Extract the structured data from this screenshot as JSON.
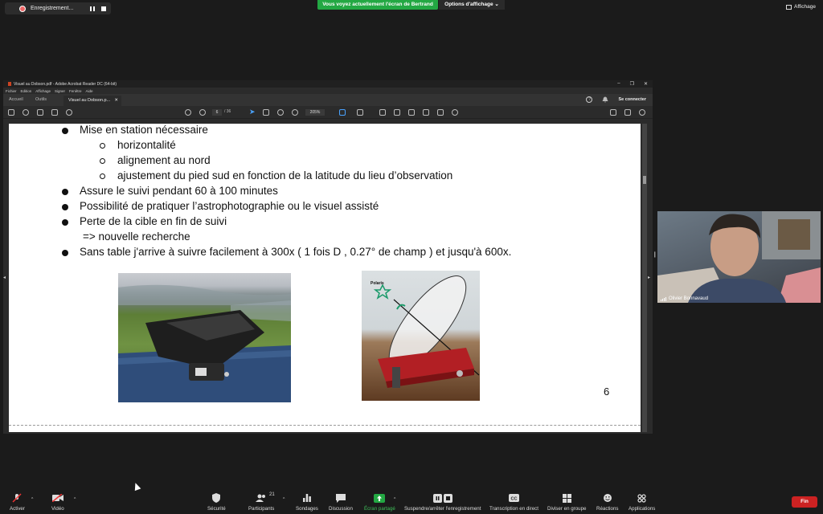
{
  "top": {
    "recording_label": "Enregistrement...",
    "share_banner": "Vous voyez actuellement l'écran de Bertrand",
    "view_options": "Options d'affichage",
    "view_options_caret": "⌄",
    "affichage": "Affichage"
  },
  "acrobat": {
    "window_title": "Visuel au Dobson.pdf - Adobe Acrobat Reader DC (64-bit)",
    "window_controls": [
      "–",
      "❐",
      "✕"
    ],
    "menu": [
      "Fichier",
      "Edition",
      "Affichage",
      "Signer",
      "Fenêtre",
      "Aide"
    ],
    "tabs": [
      "Accueil",
      "Outils"
    ],
    "doc_tab": "Visuel au Dobson.p...",
    "doc_tab_close": "✕",
    "help_glyph": "?",
    "connect": "Se connecter",
    "page_current": "6",
    "page_total": "/ 36",
    "zoom": "205%"
  },
  "slide": {
    "lines": [
      "Mise en station nécessaire",
      "horizontalité",
      "alignement au nord",
      "ajustement du pied sud en fonction de la latitude du lieu d’observation",
      "Assure le suivi pendant 60 à 100 minutes",
      "Possibilité de pratiquer l’astrophotographie ou le visuel assisté",
      "Perte de la cible en fin de suivi",
      "=> nouvelle recherche",
      "Sans table j'arrive à suivre facilement à 300x ( 1 fois D , 0.27° de champ ) et jusqu'à 600x."
    ],
    "photo2_label": "Polaris",
    "slide_number": "6"
  },
  "webcam": {
    "name": "Olivier Bonnavaud"
  },
  "bottom": {
    "items": [
      "Activer",
      "Vidéo",
      "Sécurité",
      "Participants",
      "Sondages",
      "Discussion",
      "Écran partagé",
      "Suspendre/arrêter l'enregistrement",
      "Transcription en direct",
      "Diviser en groupe",
      "Réactions",
      "Applications"
    ],
    "participants_count": "21",
    "end": "Fin"
  },
  "colors": {
    "share_green": "#23a843",
    "end_red": "#cc2222",
    "acrobat_blue": "#4aa3ff"
  }
}
